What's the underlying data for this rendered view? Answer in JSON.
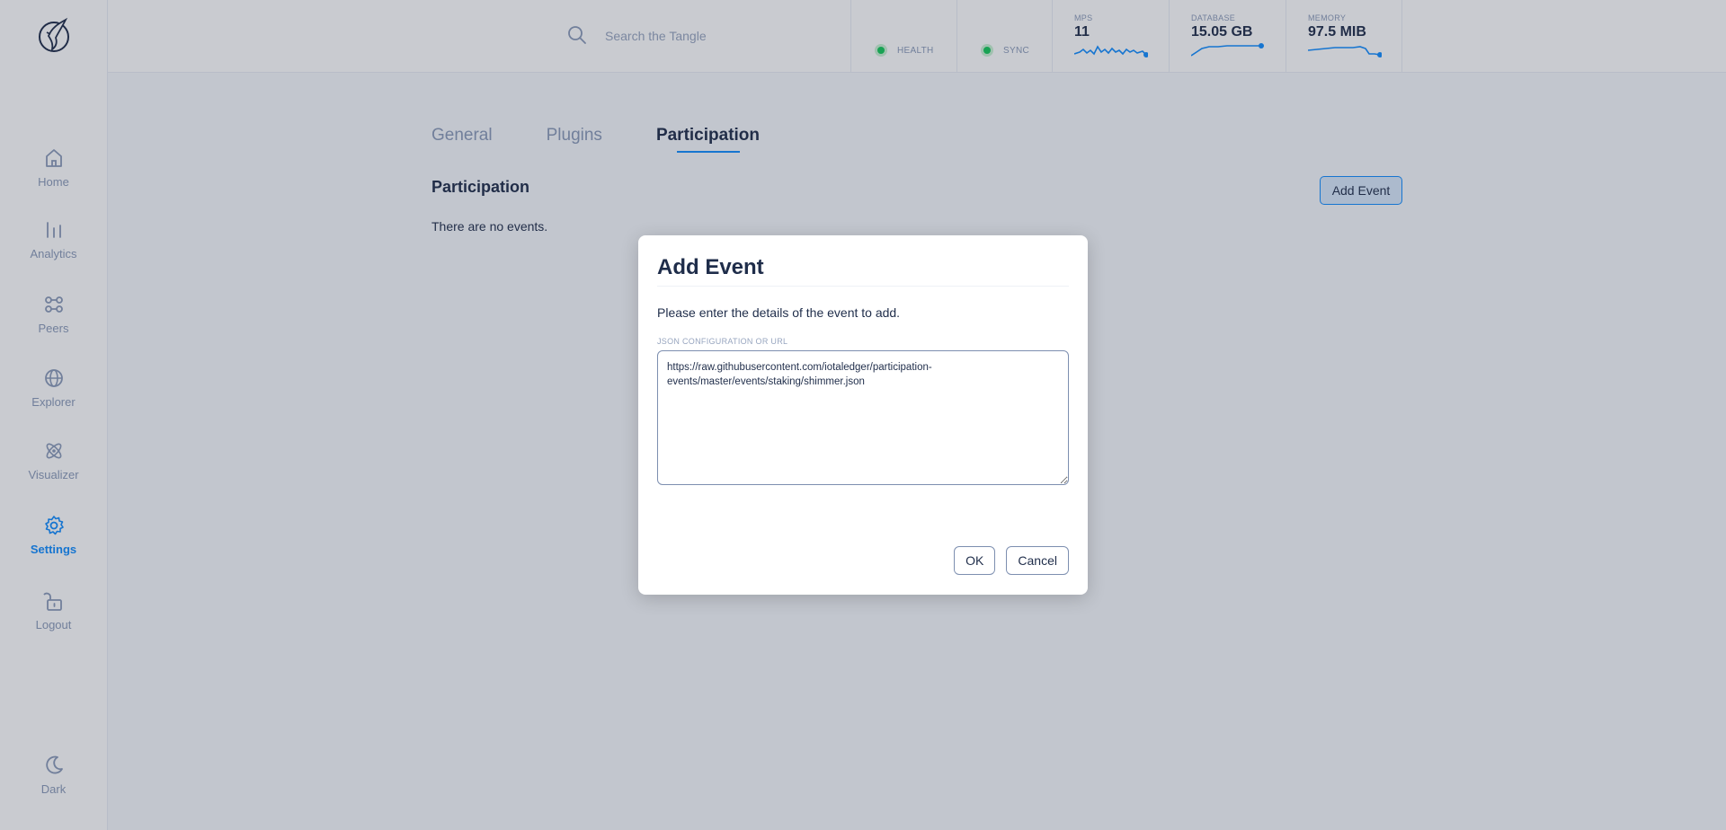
{
  "sidebar": {
    "logo_icon": "hummingbird-logo-icon",
    "items": [
      {
        "label": "Home",
        "icon": "home-icon"
      },
      {
        "label": "Analytics",
        "icon": "analytics-icon"
      },
      {
        "label": "Peers",
        "icon": "peers-icon"
      },
      {
        "label": "Explorer",
        "icon": "globe-icon"
      },
      {
        "label": "Visualizer",
        "icon": "atom-icon"
      },
      {
        "label": "Settings",
        "icon": "gear-icon",
        "active": true
      },
      {
        "label": "Logout",
        "icon": "unlock-icon"
      }
    ],
    "theme_toggle": {
      "label": "Dark",
      "icon": "moon-icon"
    }
  },
  "header": {
    "search": {
      "placeholder": "Search the Tangle",
      "value": ""
    },
    "health": {
      "label": "HEALTH",
      "status_color": "#14c95a"
    },
    "sync": {
      "label": "SYNC",
      "status_color": "#14c95a"
    },
    "mps": {
      "label": "MPS",
      "value": "11"
    },
    "database": {
      "label": "DATABASE",
      "value": "15.05 GB"
    },
    "memory": {
      "label": "MEMORY",
      "value": "97.5 MIB"
    }
  },
  "main": {
    "tabs": [
      {
        "label": "General",
        "active": false
      },
      {
        "label": "Plugins",
        "active": false
      },
      {
        "label": "Participation",
        "active": true
      }
    ],
    "section_title": "Participation",
    "empty_text": "There are no events.",
    "add_event_label": "Add Event"
  },
  "modal": {
    "title": "Add Event",
    "description": "Please enter the details of the event to add.",
    "field_label": "JSON CONFIGURATION OR URL",
    "field_value": "https://raw.githubusercontent.com/iotaledger/participation-events/master/events/staking/shimmer.json",
    "ok_label": "OK",
    "cancel_label": "Cancel"
  },
  "colors": {
    "accent": "#108cff",
    "text": "#1f2d4a",
    "muted": "#8a9ab8",
    "healthy": "#14c95a"
  }
}
